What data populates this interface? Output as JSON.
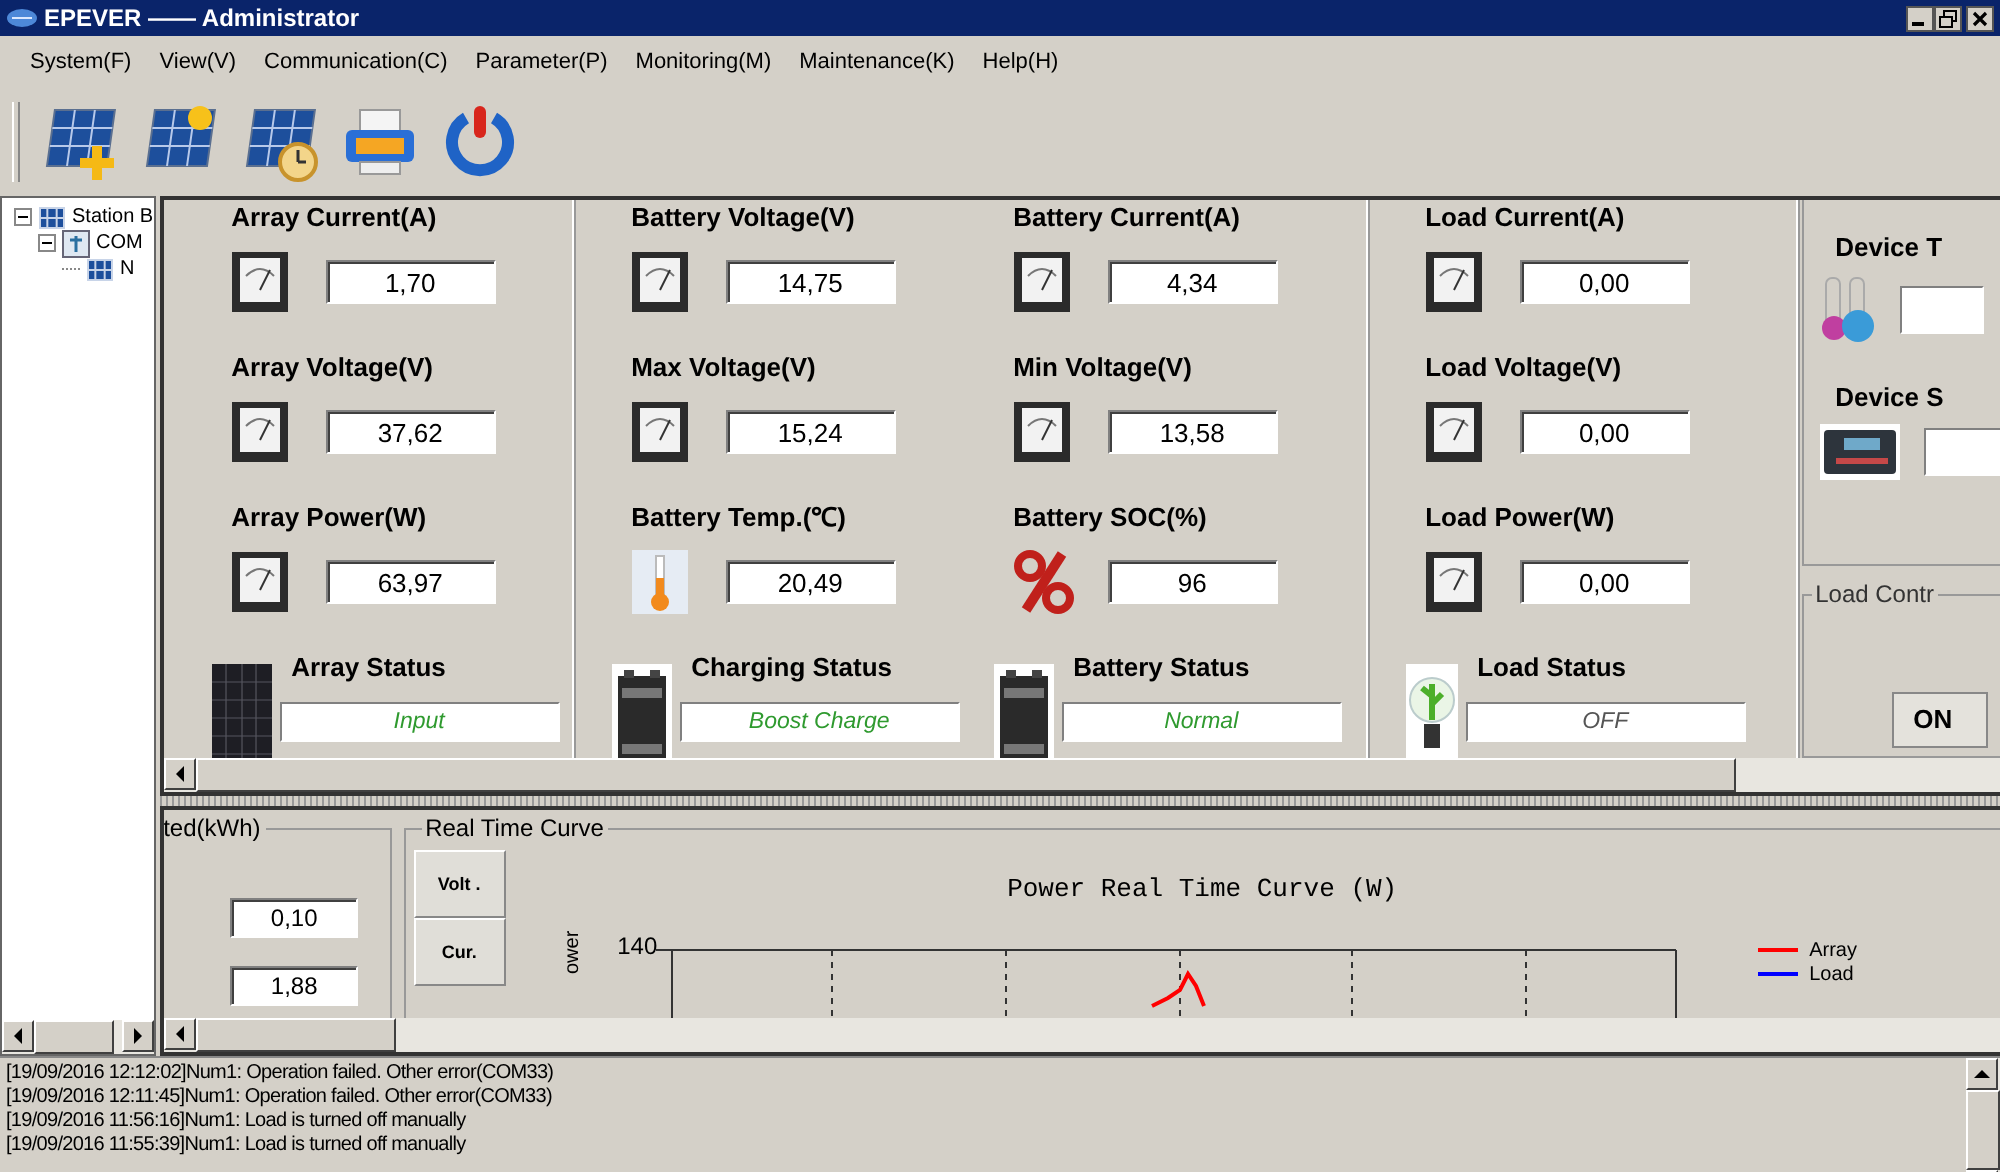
{
  "window": {
    "title": "EPEVER —— Administrator"
  },
  "menu": [
    "System(F)",
    "View(V)",
    "Communication(C)",
    "Parameter(P)",
    "Monitoring(M)",
    "Maintenance(K)",
    "Help(H)"
  ],
  "tree": [
    {
      "label": "Station B",
      "kind": "panel",
      "expanded": true,
      "children": [
        {
          "label": "COM",
          "kind": "port",
          "expanded": true,
          "children": [
            {
              "label": "N",
              "kind": "panel"
            }
          ]
        }
      ]
    }
  ],
  "monitor": {
    "groups": [
      {
        "columns": [
          {
            "metrics": [
              {
                "label": "Array Current(A)",
                "kind": "gauge",
                "value": "1,70"
              },
              {
                "label": "Array Voltage(V)",
                "kind": "gauge",
                "value": "37,62"
              },
              {
                "label": "Array Power(W)",
                "kind": "gauge",
                "value": "63,97"
              }
            ],
            "status": {
              "label": "Array Status",
              "kind": "solar-panel",
              "value": "Input",
              "color": "#2f9a2f"
            }
          }
        ]
      },
      {
        "columns": [
          {
            "metrics": [
              {
                "label": "Battery Voltage(V)",
                "kind": "gauge",
                "value": "14,75"
              },
              {
                "label": "Max Voltage(V)",
                "kind": "gauge",
                "value": "15,24"
              },
              {
                "label": "Battery Temp.(℃)",
                "kind": "thermometer",
                "value": "20,49"
              }
            ],
            "status": {
              "label": "Charging Status",
              "kind": "battery",
              "value": "Boost Charge",
              "color": "#2f9a2f"
            }
          },
          {
            "metrics": [
              {
                "label": "Battery Current(A)",
                "kind": "gauge",
                "value": "4,34"
              },
              {
                "label": "Min Voltage(V)",
                "kind": "gauge",
                "value": "13,58"
              },
              {
                "label": "Battery SOC(%)",
                "kind": "percent",
                "value": "96"
              }
            ],
            "status": {
              "label": "Battery Status",
              "kind": "battery",
              "value": "Normal",
              "color": "#2f9a2f"
            }
          }
        ]
      },
      {
        "columns": [
          {
            "metrics": [
              {
                "label": "Load Current(A)",
                "kind": "gauge",
                "value": "0,00"
              },
              {
                "label": "Load Voltage(V)",
                "kind": "gauge",
                "value": "0,00"
              },
              {
                "label": "Load Power(W)",
                "kind": "gauge",
                "value": "0,00"
              }
            ],
            "status": {
              "label": "Load Status",
              "kind": "bulb",
              "value": "OFF",
              "color": "#555555"
            }
          }
        ]
      }
    ],
    "device": {
      "items": [
        {
          "label": "Device T",
          "kind": "flasks"
        },
        {
          "label": "Device S",
          "kind": "controller"
        }
      ],
      "load_control": {
        "title": "Load Contr",
        "button": "ON"
      }
    }
  },
  "energy": {
    "title": "ted(kWh)",
    "values": [
      "0,10",
      "1,88"
    ]
  },
  "curve": {
    "title": "Real Time Curve",
    "tabs": [
      {
        "label": "Volt .",
        "selected": false
      },
      {
        "label": "Cur.",
        "selected": false
      }
    ],
    "chart_title": "Power Real Time Curve (W)",
    "ylabel": "ower",
    "ytick": "140",
    "legend": [
      {
        "label": "Array",
        "color": "#ff0000"
      },
      {
        "label": "Load",
        "color": "#0000ff"
      }
    ]
  },
  "log": [
    "[19/09/2016 12:12:02]Num1: Operation failed. Other error(COM33)",
    "[19/09/2016 12:11:45]Num1: Operation failed. Other error(COM33)",
    "[19/09/2016 11:56:16]Num1: Load is turned off manually",
    "[19/09/2016 11:55:39]Num1: Load is turned off manually"
  ]
}
